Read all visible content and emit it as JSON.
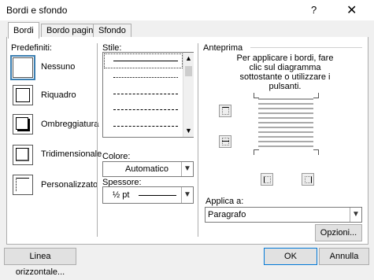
{
  "window": {
    "title": "Bordi e sfondo",
    "help_glyph": "?",
    "close_glyph": "✕"
  },
  "tabs": [
    {
      "label": "Bordi"
    },
    {
      "label": "Bordo pagina"
    },
    {
      "label": "Sfondo"
    }
  ],
  "predefiniti": {
    "label": "Predefiniti:",
    "items": [
      {
        "label": "Nessuno"
      },
      {
        "label": "Riquadro"
      },
      {
        "label": "Ombreggiatura"
      },
      {
        "label": "Tridimensionale"
      },
      {
        "label": "Personalizzato"
      }
    ]
  },
  "stile": {
    "label": "Stile:"
  },
  "colore": {
    "label": "Colore:",
    "value": "Automatico"
  },
  "spessore": {
    "label": "Spessore:",
    "value": "½ pt"
  },
  "anteprima": {
    "label": "Anteprima",
    "instructions": "Per applicare i bordi, fare clic sul diagramma sottostante o utilizzare i pulsanti."
  },
  "applica": {
    "label": "Applica a:",
    "value": "Paragrafo"
  },
  "buttons": {
    "opzioni": "Opzioni...",
    "linea": "Linea orizzontale...",
    "ok": "OK",
    "annulla": "Annulla"
  }
}
